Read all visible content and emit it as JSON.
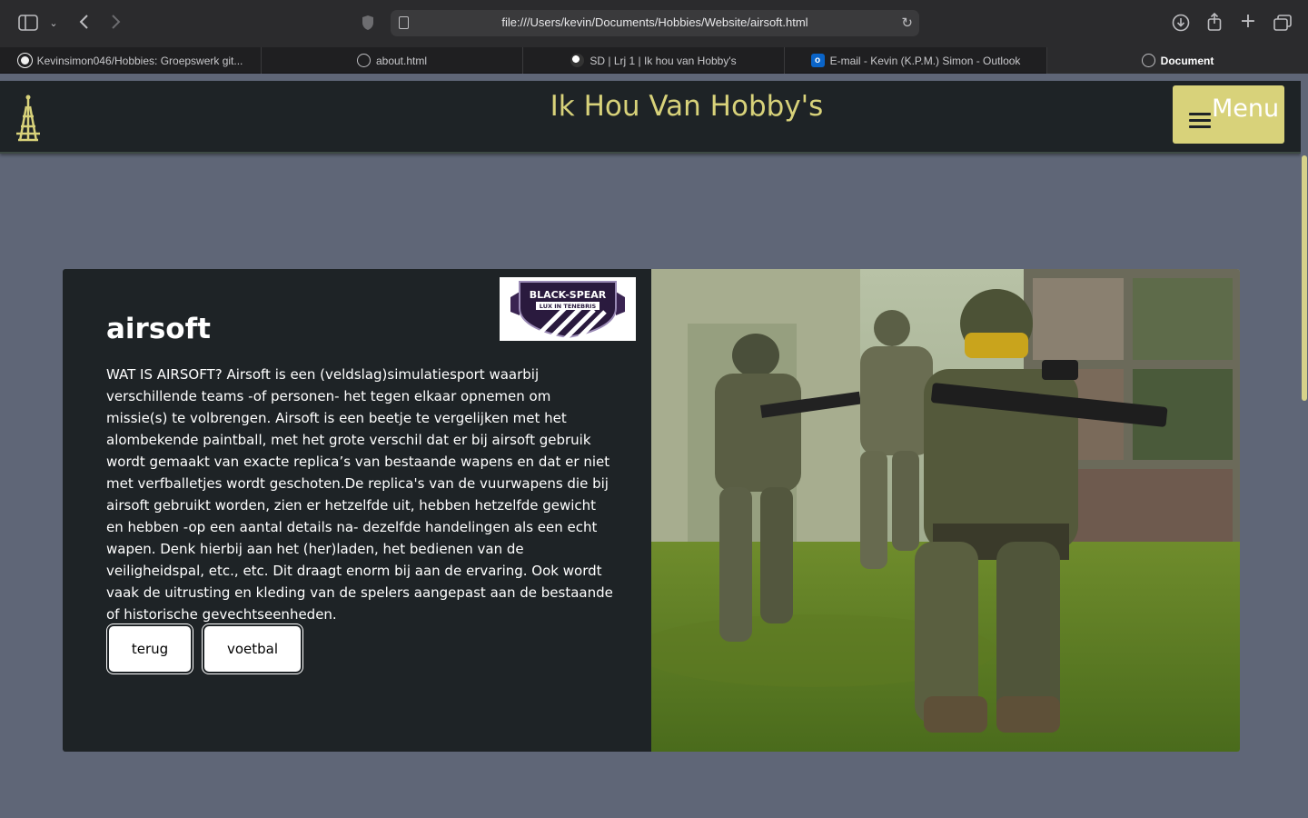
{
  "browser": {
    "url": "file:///Users/kevin/Documents/Hobbies/Website/airsoft.html",
    "tabs": [
      {
        "label": "Kevinsimon046/Hobbies: Groepswerk git...",
        "favicon": "github-icon"
      },
      {
        "label": "about.html",
        "favicon": "compass-icon"
      },
      {
        "label": "SD | Lrj 1 | Ik hou van Hobby's",
        "favicon": "site-icon"
      },
      {
        "label": "E-mail - Kevin (K.P.M.) Simon - Outlook",
        "favicon": "outlook-icon"
      },
      {
        "label": "Document",
        "favicon": "compass-icon",
        "active": true
      }
    ]
  },
  "site": {
    "title": "Ik Hou Van Hobby's",
    "menu_label": "Menu",
    "accent_color": "#d8d27a",
    "header_bg": "#1e2326",
    "page_bg": "#5f6677"
  },
  "card": {
    "heading": "airsoft",
    "text": "WAT IS AIRSOFT? Airsoft is een (veldslag)simulatiesport waarbij verschillende teams -of personen- het tegen elkaar opnemen om missie(s) te volbrengen. Airsoft is een beetje te vergelijken met het alombekende paintball, met het grote verschil dat er bij airsoft gebruik wordt gemaakt van exacte replica’s van bestaande wapens en dat er niet met verfballetjes wordt geschoten.De replica's van de vuurwapens die bij airsoft gebruikt worden, zien er hetzelfde uit, hebben hetzelfde gewicht en hebben -op een aantal details na- dezelfde handelingen als een echt wapen. Denk hierbij aan het (her)laden, het bedienen van de veiligheidspal, etc., etc. Dit draagt enorm bij aan de ervaring. Ook wordt vaak de uitrusting en kleding van de spelers aangepast aan de bestaande of historische gevechtseenheden.",
    "badge_line1": "BLACK-SPEAR",
    "badge_line2": "LUX IN TENEBRIS",
    "buttons": {
      "back": "terug",
      "next": "voetbal"
    }
  }
}
